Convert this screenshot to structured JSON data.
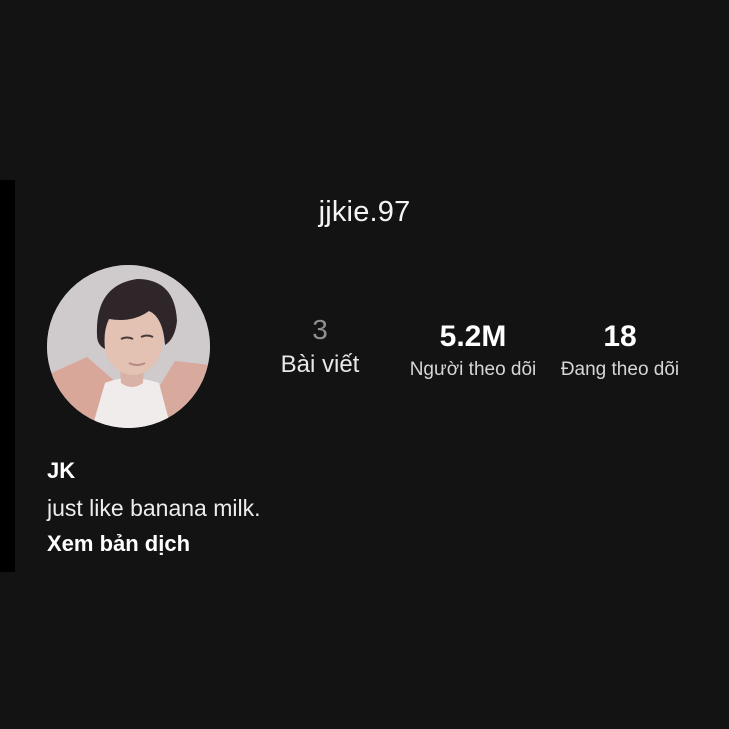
{
  "profile": {
    "username": "jjkie.97",
    "display_name": "JK",
    "bio": "just like banana milk.",
    "translate_link": "Xem bản dịch"
  },
  "stats": {
    "posts": {
      "value": "3",
      "label": "Bài viết"
    },
    "followers": {
      "value": "5.2M",
      "label": "Người theo dõi"
    },
    "following": {
      "value": "18",
      "label": "Đang theo dõi"
    }
  },
  "colors": {
    "background": "#141314",
    "text_primary": "#ffffff",
    "text_muted": "#8f8f8f"
  }
}
